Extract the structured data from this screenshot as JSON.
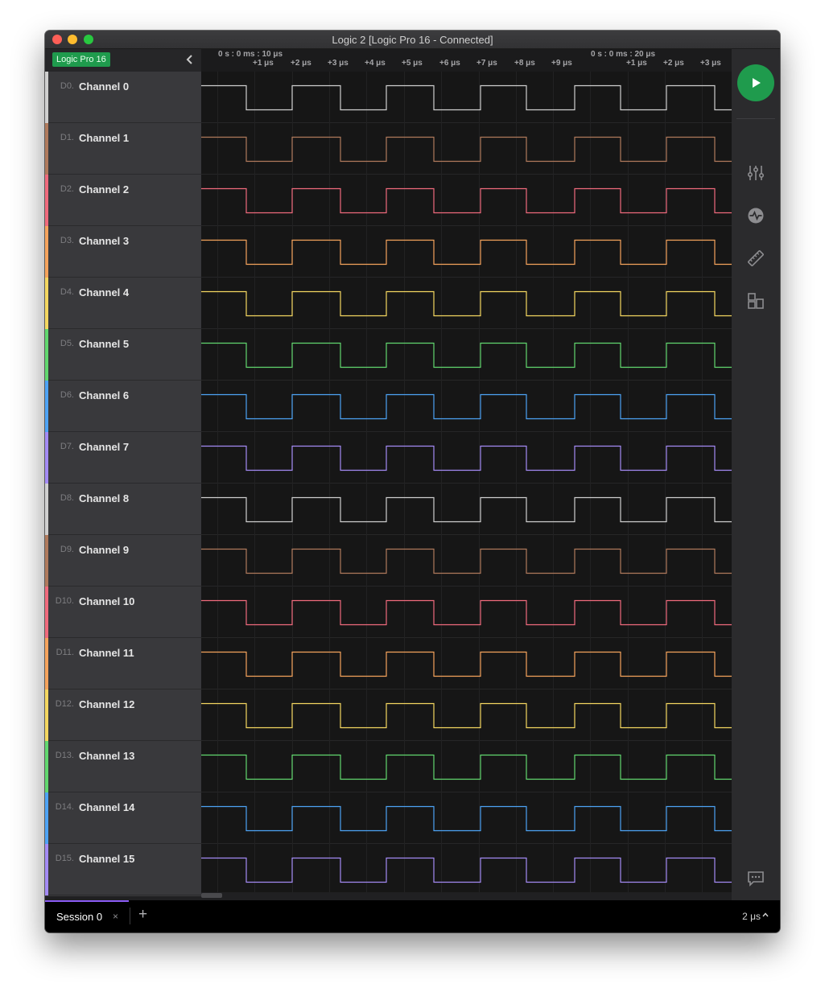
{
  "window": {
    "title": "Logic 2 [Logic Pro 16 - Connected]"
  },
  "device": {
    "badge": "Logic Pro 16"
  },
  "timeline": {
    "anchors": [
      "0 s : 0 ms : 10 μs",
      "0 s : 0 ms : 20 μs"
    ],
    "ticks": [
      "+1 μs",
      "+2 μs",
      "+3 μs",
      "+4 μs",
      "+5 μs",
      "+6 μs",
      "+7 μs",
      "+8 μs",
      "+9 μs",
      "+1 μs",
      "+2 μs",
      "+3 μs"
    ]
  },
  "channels": [
    {
      "num": "D0.",
      "name": "Channel 0",
      "color": "#cfcfcf"
    },
    {
      "num": "D1.",
      "name": "Channel 1",
      "color": "#b07a5c"
    },
    {
      "num": "D2.",
      "name": "Channel 2",
      "color": "#f06a7d"
    },
    {
      "num": "D3.",
      "name": "Channel 3",
      "color": "#f5a35c"
    },
    {
      "num": "D4.",
      "name": "Channel 4",
      "color": "#f4d760"
    },
    {
      "num": "D5.",
      "name": "Channel 5",
      "color": "#62d86f"
    },
    {
      "num": "D6.",
      "name": "Channel 6",
      "color": "#4da3f5"
    },
    {
      "num": "D7.",
      "name": "Channel 7",
      "color": "#a48bf5"
    },
    {
      "num": "D8.",
      "name": "Channel 8",
      "color": "#cfcfcf"
    },
    {
      "num": "D9.",
      "name": "Channel 9",
      "color": "#b07a5c"
    },
    {
      "num": "D10.",
      "name": "Channel 10",
      "color": "#f06a7d"
    },
    {
      "num": "D11.",
      "name": "Channel 11",
      "color": "#f5a35c"
    },
    {
      "num": "D12.",
      "name": "Channel 12",
      "color": "#f4d760"
    },
    {
      "num": "D13.",
      "name": "Channel 13",
      "color": "#62d86f"
    },
    {
      "num": "D14.",
      "name": "Channel 14",
      "color": "#4da3f5"
    },
    {
      "num": "D15.",
      "name": "Channel 15",
      "color": "#a48bf5"
    }
  ],
  "right_panel": {
    "icons": [
      "play-icon",
      "sliders-icon",
      "pulse-icon",
      "ruler-icon",
      "extensions-icon",
      "chat-icon",
      "menu-icon"
    ]
  },
  "session": {
    "tab_label": "Session 0",
    "close_glyph": "×",
    "add_glyph": "+"
  },
  "timescale": "2 μs"
}
